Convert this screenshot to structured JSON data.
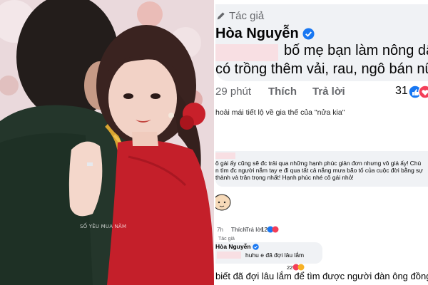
{
  "photo": {
    "watermark": "SỐ YÊU MUA NĂM"
  },
  "zoom_comment": {
    "tag": "Tác giả",
    "author": "Hòa Nguyễn",
    "line1": "bố mẹ bạn làm nông dân,",
    "line2": "có trồng thêm vải, rau, ngô bán nữa ạ",
    "time": "29 phút",
    "like": "Thích",
    "reply": "Trả lời",
    "count": "31"
  },
  "caption": "hoải mái tiết lộ về gia thế của \"nửa kia\"",
  "small_comment": {
    "lines": [
      "ô gái ấy cũng sẽ đc trải qua những hạnh phúc giản đơn nhưng vô giá ấy! Chú",
      "n tìm đc người nắm tay e đi qua tất cả nắng mưa bão tố của cuộc đời bằng sự",
      "thành và trân trọng nhất! Hạnh phúc nhé cô gái nhỏ!"
    ],
    "time": "7h",
    "like": "Thích",
    "reply": "Trả lời",
    "count": "12"
  },
  "reply_comment": {
    "tag": "Tác giả",
    "author": "Hòa Nguyễn",
    "text": "huhu e đã đợi lâu lắm",
    "count": "22"
  },
  "bottom_line": "biết đã đợi lâu lắm để tìm được người đàn ông đồng hành cù",
  "colors": {
    "facebook_blue": "#1877f2",
    "heart_red": "#f33e58",
    "bubble_gray": "#f0f2f5",
    "redaction_pink": "#f8dfe3"
  }
}
